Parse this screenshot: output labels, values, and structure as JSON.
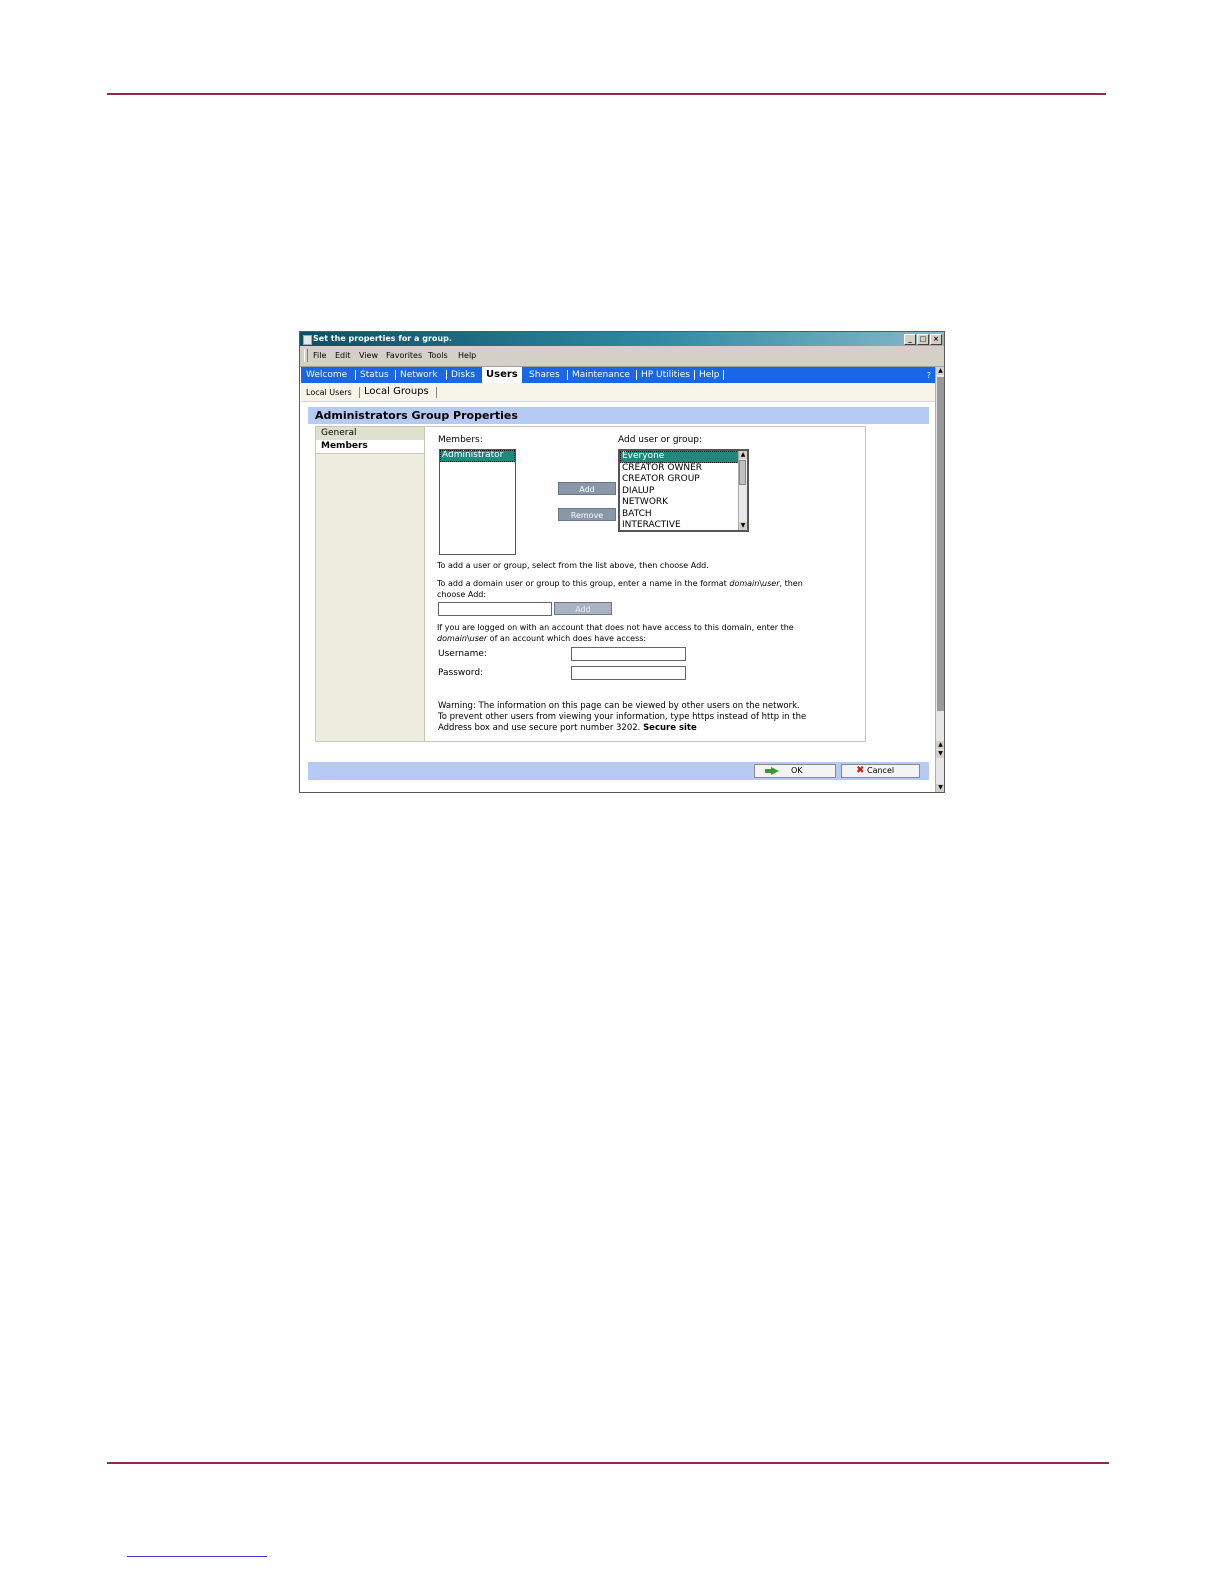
{
  "window": {
    "title": "Set the properties for a group.",
    "controls": {
      "minimize": "_",
      "maximize": "□",
      "close": "×"
    }
  },
  "menu": [
    "File",
    "Edit",
    "View",
    "Favorites",
    "Tools",
    "Help"
  ],
  "nav": {
    "tabs": [
      "Welcome",
      "Status",
      "Network",
      "Disks",
      "Users",
      "Shares",
      "Maintenance",
      "HP Utilities",
      "Help"
    ],
    "active": "Users",
    "help_glyph": "?"
  },
  "subnav": {
    "items": [
      "Local Users",
      "Local Groups"
    ],
    "active": "Local Groups"
  },
  "page": {
    "title": "Administrators Group Properties",
    "left_tabs": [
      "General",
      "Members"
    ],
    "members_label": "Members:",
    "members": [
      "Administrator"
    ],
    "add_label": "Add user or group:",
    "available": [
      "Everyone",
      "CREATOR OWNER",
      "CREATOR GROUP",
      "DIALUP",
      "NETWORK",
      "BATCH",
      "INTERACTIVE"
    ],
    "add_button": "Add",
    "remove_button": "Remove",
    "instruction_1": "To add a user or group, select from the list above, then choose Add.",
    "instruction_2a": "To add a domain user or group to this group, enter a name in the format ",
    "instruction_2_domain": "domain",
    "instruction_2_sep": "\\",
    "instruction_2_user": "user",
    "instruction_2b": ", then",
    "instruction_2c": "choose Add:",
    "domain_add_button": "Add",
    "instruction_3a": "If you are logged on with an account that does not have access to this domain, enter the",
    "instruction_3_domain": "domain",
    "instruction_3_sep": "\\",
    "instruction_3_user": "user",
    "instruction_3b": " of an account which does have access:",
    "username_label": "Username:",
    "password_label": "Password:",
    "warning_1": "Warning: The information on this page can be viewed by other users on the network.",
    "warning_2": "To prevent other users from viewing your information, type https instead of http in the",
    "warning_3": "Address box and use secure port number 3202. ",
    "secure_site": "Secure site"
  },
  "footer": {
    "ok": "OK",
    "cancel": "Cancel"
  },
  "colors": {
    "accent_rule": "#8b2a55",
    "nav_blue": "#1767e6",
    "header_band": "#b7caf3",
    "selection": "#1f8a7c"
  }
}
